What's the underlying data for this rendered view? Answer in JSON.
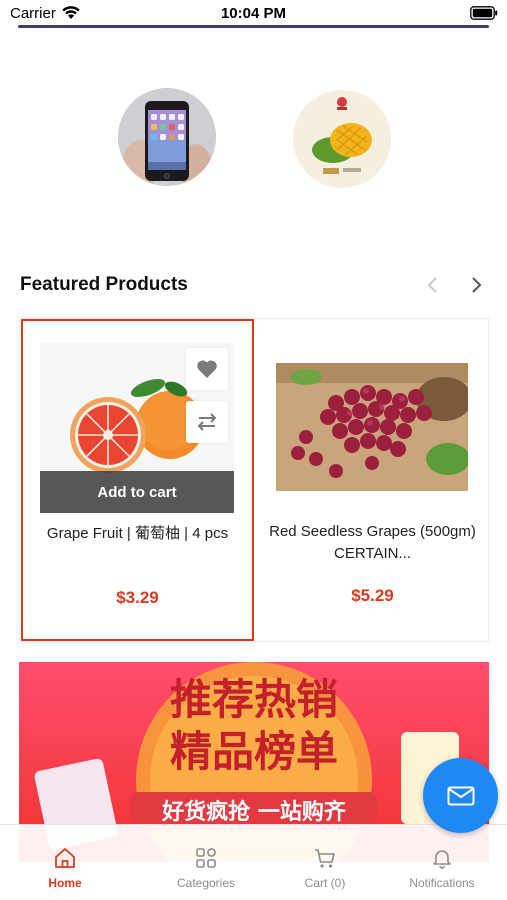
{
  "status_bar": {
    "carrier": "Carrier",
    "time": "10:04 PM"
  },
  "categories": [
    {
      "name": "phone-category",
      "image": "smartphone"
    },
    {
      "name": "mango-category",
      "image": "mango"
    }
  ],
  "featured": {
    "title": "Featured Products",
    "products": [
      {
        "name": "Grape Fruit | 葡萄柚 | 4 pcs",
        "price": "$3.29",
        "add_to_cart_label": "Add to cart",
        "selected": true
      },
      {
        "name": "Red Seedless Grapes (500gm) CERTAIN...",
        "price": "$5.29",
        "selected": false
      }
    ]
  },
  "banner": {
    "title_line1": "推荐热销",
    "title_line2": "精品榜单",
    "subtitle": "好货疯抢 一站购齐"
  },
  "bottom_nav": {
    "items": [
      {
        "label": "Home",
        "icon": "home-icon",
        "active": true
      },
      {
        "label": "Categories",
        "icon": "grid-icon",
        "active": false
      },
      {
        "label": "Cart (0)",
        "icon": "cart-icon",
        "active": false
      },
      {
        "label": "Notifications",
        "icon": "bell-icon",
        "active": false
      }
    ]
  },
  "colors": {
    "accent": "#dc3a1c",
    "fab": "#1e88f5",
    "header_divider": "#3f3f6a"
  }
}
